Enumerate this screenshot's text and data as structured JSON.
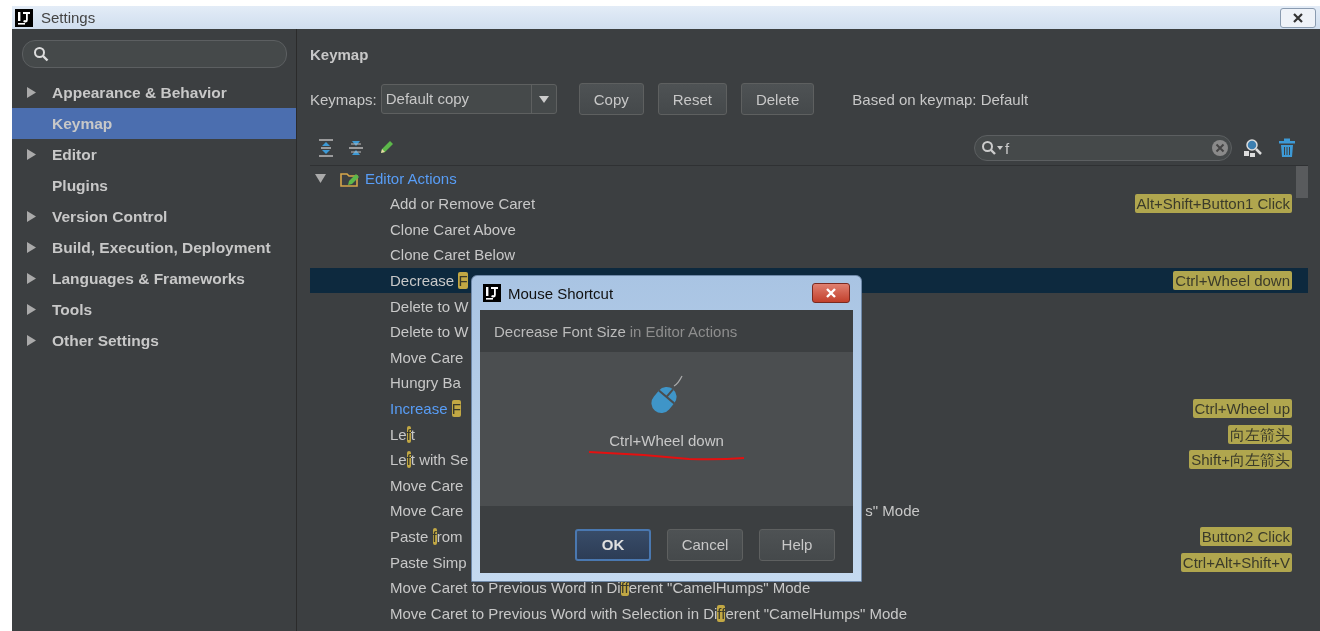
{
  "window": {
    "title": "Settings"
  },
  "sidebar": {
    "items": [
      {
        "label": "Appearance & Behavior",
        "expandable": true,
        "selected": false
      },
      {
        "label": "Keymap",
        "expandable": false,
        "selected": true
      },
      {
        "label": "Editor",
        "expandable": true,
        "selected": false
      },
      {
        "label": "Plugins",
        "expandable": false,
        "selected": false
      },
      {
        "label": "Version Control",
        "expandable": true,
        "selected": false
      },
      {
        "label": "Build, Execution, Deployment",
        "expandable": true,
        "selected": false
      },
      {
        "label": "Languages & Frameworks",
        "expandable": true,
        "selected": false
      },
      {
        "label": "Tools",
        "expandable": true,
        "selected": false
      },
      {
        "label": "Other Settings",
        "expandable": true,
        "selected": false
      }
    ]
  },
  "keymap": {
    "heading": "Keymap",
    "keymaps_label": "Keymaps:",
    "keymap_value": "Default copy",
    "buttons": [
      "Copy",
      "Reset",
      "Delete"
    ],
    "based_on": "Based on keymap: Default",
    "filter": {
      "value": "f"
    },
    "tree": {
      "label": "Editor Actions",
      "expanded": true,
      "children": [
        {
          "segments": [
            {
              "text": "Add or Remove Caret",
              "match": false
            }
          ],
          "shortcut": "Alt+Shift+Button1 Click",
          "selected": false,
          "modified": false
        },
        {
          "segments": [
            {
              "text": "Clone Caret Above",
              "match": false
            }
          ],
          "selected": false,
          "modified": false
        },
        {
          "segments": [
            {
              "text": "Clone Caret Below",
              "match": false
            }
          ],
          "selected": false,
          "modified": false
        },
        {
          "segments": [
            {
              "text": "Decrease ",
              "match": false
            },
            {
              "text": "F",
              "match": true
            }
          ],
          "shortcut": "Ctrl+Wheel down",
          "selected": true,
          "modified": false
        },
        {
          "segments": [
            {
              "text": "Delete to W",
              "match": false
            }
          ],
          "selected": false,
          "modified": false
        },
        {
          "segments": [
            {
              "text": "Delete to W",
              "match": false
            }
          ],
          "selected": false,
          "modified": false
        },
        {
          "segments": [
            {
              "text": "Move Care",
              "match": false
            }
          ],
          "selected": false,
          "modified": false
        },
        {
          "segments": [
            {
              "text": "Hungry Ba",
              "match": false
            }
          ],
          "selected": false,
          "modified": false
        },
        {
          "segments": [
            {
              "text": "Increase ",
              "match": false
            },
            {
              "text": "F",
              "match": true
            }
          ],
          "shortcut": "Ctrl+Wheel up",
          "selected": false,
          "modified": true
        },
        {
          "segments": [
            {
              "text": "Le",
              "match": false
            },
            {
              "text": "f",
              "match": true
            },
            {
              "text": "t",
              "match": false
            }
          ],
          "shortcut": "向左箭头",
          "selected": false,
          "modified": false
        },
        {
          "segments": [
            {
              "text": "Le",
              "match": false
            },
            {
              "text": "f",
              "match": true
            },
            {
              "text": "t with Se",
              "match": false
            }
          ],
          "shortcut": "Shift+向左箭头",
          "selected": false,
          "modified": false
        },
        {
          "segments": [
            {
              "text": "Move Care",
              "match": false
            }
          ],
          "selected": false,
          "modified": false
        },
        {
          "segments": [
            {
              "text": "Move Care",
              "match": false
            }
          ],
          "tail": "s\" Mode",
          "selected": false,
          "modified": false
        },
        {
          "segments": [
            {
              "text": "Paste ",
              "match": false
            },
            {
              "text": "f",
              "match": true
            },
            {
              "text": "rom",
              "match": false
            }
          ],
          "shortcut": "Button2 Click",
          "selected": false,
          "modified": false
        },
        {
          "segments": [
            {
              "text": "Paste Simp",
              "match": false
            }
          ],
          "shortcut": "Ctrl+Alt+Shift+V",
          "selected": false,
          "modified": false
        },
        {
          "segments": [
            {
              "text": "Move Caret to Previous Word in Di",
              "match": false
            },
            {
              "text": "ff",
              "match": true
            },
            {
              "text": "erent \"CamelHumps\" Mode",
              "match": false
            }
          ],
          "selected": false,
          "modified": false
        },
        {
          "segments": [
            {
              "text": "Move Caret to Previous Word with Selection in Di",
              "match": false
            },
            {
              "text": "ff",
              "match": true
            },
            {
              "text": "erent \"CamelHumps\" Mode",
              "match": false
            }
          ],
          "selected": false,
          "modified": false
        }
      ]
    }
  },
  "dialog": {
    "title": "Mouse Shortcut",
    "action": "Decrease Font Size",
    "context": "in Editor Actions",
    "shortcut": "Ctrl+Wheel down",
    "buttons": [
      {
        "label": "OK",
        "default": true
      },
      {
        "label": "Cancel",
        "default": false
      },
      {
        "label": "Help",
        "default": false
      }
    ]
  }
}
